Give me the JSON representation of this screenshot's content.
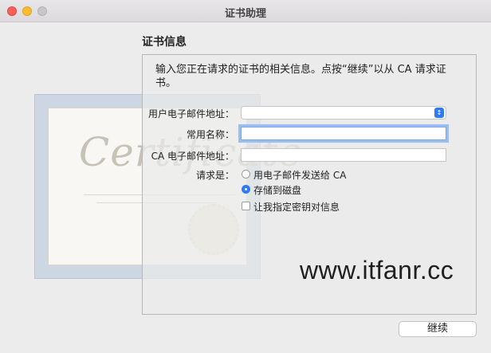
{
  "window": {
    "title": "证书助理"
  },
  "section": {
    "title": "证书信息",
    "instruction": "输入您正在请求的证书的相关信息。点按“继续”以从 CA 请求证书。"
  },
  "form": {
    "user_email_label": "用户电子邮件地址：",
    "user_email_value": "",
    "common_name_label": "常用名称：",
    "common_name_value": "",
    "ca_email_label": "CA 电子邮件地址：",
    "ca_email_value": "",
    "request_label": "请求是：",
    "option_email": "用电子邮件发送给 CA",
    "option_disk": "存储到磁盘",
    "option_selected": "存储到磁盘",
    "specify_key_label": "让我指定密钥对信息",
    "specify_key_checked": false
  },
  "certificate_art": {
    "word": "Certificate"
  },
  "watermark": {
    "text": "www.itfanr.cc"
  },
  "buttons": {
    "continue_label": "继续"
  },
  "colors": {
    "accent": "#2f7bf6",
    "focus_ring": "#9bbdf2",
    "close": "#fe5f57",
    "minimize": "#febc2e"
  },
  "icons": [
    "close-icon",
    "minimize-icon",
    "zoom-icon",
    "chevron-updown-icon"
  ]
}
